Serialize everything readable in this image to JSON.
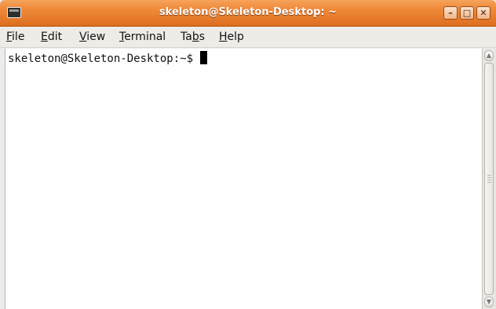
{
  "window": {
    "title": "skeleton@Skeleton-Desktop: ~",
    "controls": {
      "minimize": "–",
      "maximize": "□",
      "close": "✕"
    }
  },
  "menu": [
    {
      "pre": "",
      "u": "F",
      "post": "ile"
    },
    {
      "pre": "",
      "u": "E",
      "post": "dit"
    },
    {
      "pre": "",
      "u": "V",
      "post": "iew"
    },
    {
      "pre": "",
      "u": "T",
      "post": "erminal"
    },
    {
      "pre": "Ta",
      "u": "b",
      "post": "s"
    },
    {
      "pre": "",
      "u": "H",
      "post": "elp"
    }
  ],
  "terminal": {
    "prompt": "skeleton@Skeleton-Desktop:~$ "
  },
  "scrollbar": {
    "up_arrow": "▲",
    "down_arrow": "▼"
  },
  "icons": {
    "title": "terminal-icon",
    "minimize": "minimize-icon",
    "maximize": "maximize-icon",
    "close": "close-icon"
  }
}
